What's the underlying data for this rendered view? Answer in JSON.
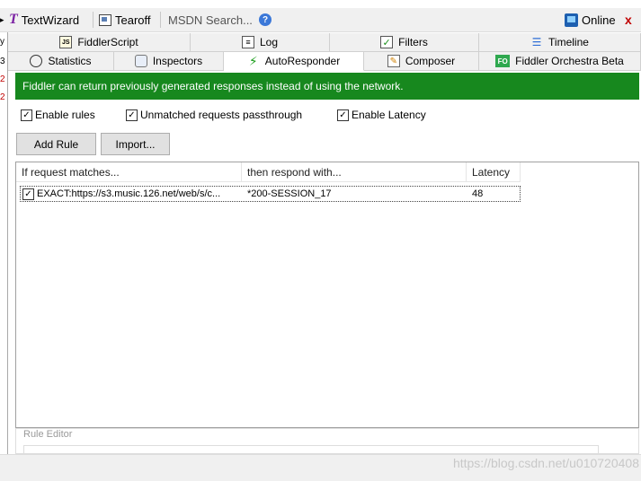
{
  "toolbar": {
    "textwizard_label": "TextWizard",
    "tearoff_label": "Tearoff",
    "search_placeholder": "MSDN Search...",
    "help_glyph": "?",
    "online_label": "Online",
    "close_glyph": "x"
  },
  "left_strip": [
    "y",
    "3",
    "2",
    "2"
  ],
  "tabs_top": [
    {
      "label": "FiddlerScript",
      "icon": "script-icon"
    },
    {
      "label": "Log",
      "icon": "log-icon"
    },
    {
      "label": "Filters",
      "icon": "filter-icon"
    },
    {
      "label": "Timeline",
      "icon": "timeline-icon"
    }
  ],
  "tabs_bottom": [
    {
      "label": "Statistics",
      "icon": "stopwatch-icon"
    },
    {
      "label": "Inspectors",
      "icon": "inspect-icon"
    },
    {
      "label": "AutoResponder",
      "icon": "lightning-icon",
      "active": true
    },
    {
      "label": "Composer",
      "icon": "composer-icon"
    },
    {
      "label": "Fiddler Orchestra Beta",
      "icon": "fo-icon",
      "icon_text": "FO"
    }
  ],
  "autoresponder": {
    "banner": "Fiddler can return previously generated responses instead of using the network.",
    "options": [
      {
        "label": "Enable rules",
        "checked": true
      },
      {
        "label": "Unmatched requests passthrough",
        "checked": true
      },
      {
        "label": "Enable Latency",
        "checked": true
      }
    ],
    "buttons": {
      "add_rule": "Add Rule",
      "import": "Import..."
    },
    "columns": [
      "If request matches...",
      "then respond with...",
      "Latency"
    ],
    "rules": [
      {
        "checked": true,
        "match": "EXACT:https://s3.music.126.net/web/s/c...",
        "respond": "*200-SESSION_17",
        "latency": "48"
      }
    ],
    "rule_editor_label": "Rule Editor"
  },
  "watermark": "https://blog.csdn.net/u010720408",
  "colors": {
    "banner_bg": "#17881e",
    "close_red": "#c00000"
  }
}
